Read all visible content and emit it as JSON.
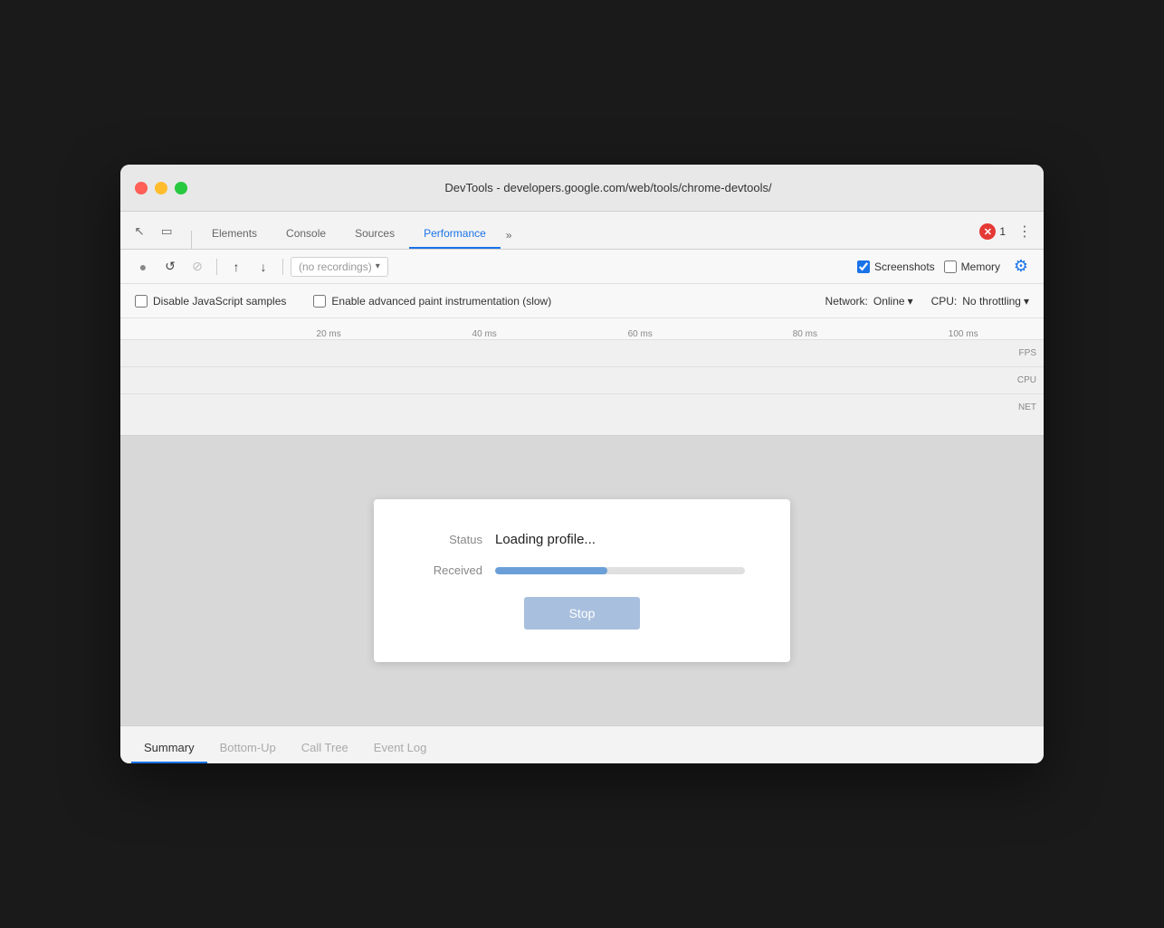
{
  "window": {
    "title": "DevTools - developers.google.com/web/tools/chrome-devtools/"
  },
  "tabs": {
    "items": [
      {
        "label": "Elements",
        "active": false
      },
      {
        "label": "Console",
        "active": false
      },
      {
        "label": "Sources",
        "active": false
      },
      {
        "label": "Performance",
        "active": true
      }
    ],
    "more_label": "»",
    "error_count": "1",
    "menu_icon": "⋮"
  },
  "toolbar": {
    "record_tooltip": "Record",
    "reload_tooltip": "Reload and record",
    "clear_tooltip": "Clear",
    "upload_tooltip": "Load profile",
    "download_tooltip": "Save profile",
    "recording_placeholder": "(no recordings)",
    "screenshots_label": "Screenshots",
    "memory_label": "Memory",
    "screenshots_checked": true,
    "memory_checked": false
  },
  "settings": {
    "disable_js_label": "Disable JavaScript samples",
    "enable_paint_label": "Enable advanced paint instrumentation (slow)",
    "network_label": "Network:",
    "network_value": "Online",
    "cpu_label": "CPU:",
    "cpu_value": "No throttling"
  },
  "timeline": {
    "ruler_marks": [
      "20 ms",
      "40 ms",
      "60 ms",
      "80 ms",
      "100 ms"
    ],
    "ruler_positions": [
      "21%",
      "38%",
      "56%",
      "74%",
      "91%"
    ],
    "track_labels": [
      "FPS",
      "CPU",
      "NET"
    ]
  },
  "loading_dialog": {
    "status_label": "Status",
    "status_value": "Loading profile...",
    "received_label": "Received",
    "progress_percent": 45,
    "stop_label": "Stop"
  },
  "bottom_tabs": {
    "items": [
      {
        "label": "Summary",
        "active": true
      },
      {
        "label": "Bottom-Up",
        "active": false
      },
      {
        "label": "Call Tree",
        "active": false
      },
      {
        "label": "Event Log",
        "active": false
      }
    ]
  },
  "icons": {
    "cursor": "↖",
    "device": "⬜",
    "close_x": "✕",
    "record_circle": "●",
    "reload": "↺",
    "no_entry": "⊘",
    "upload": "↑",
    "download": "↓",
    "gear": "⚙",
    "dropdown_arrow": "▾",
    "chevron_right": "›"
  }
}
